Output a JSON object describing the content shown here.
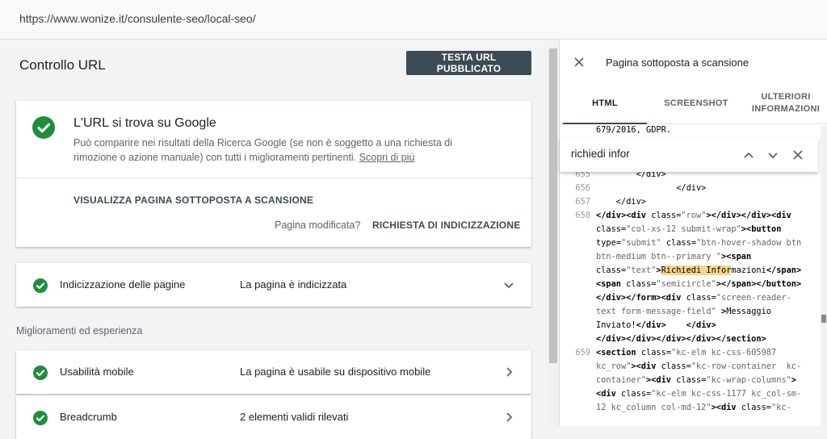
{
  "address_bar": {
    "url": "https://www.wonize.it/consulente-seo/local-seo/"
  },
  "page": {
    "title": "Controllo URL",
    "test_button": "TESTA URL PUBBLICATO"
  },
  "status": {
    "title": "L'URL si trova su Google",
    "description": "Può comparire nei risultati della Ricerca Google (se non è soggetto a una richiesta di rimozione o azione manuale) con tutti i miglioramenti pertinenti.",
    "learn_more": "Scopri di più",
    "view_crawled": "VISUALIZZA PAGINA SOTTOPOSTA A SCANSIONE",
    "modified_q": "Pagina modificata?",
    "request_indexing": "RICHIESTA DI INDICIZZAZIONE"
  },
  "indexing": {
    "label": "Indicizzazione delle pagine",
    "value": "La pagina è indicizzata"
  },
  "enhancements": {
    "header": "Miglioramenti ed esperienza",
    "items": [
      {
        "label": "Usabilità mobile",
        "value": "La pagina è usabile su dispositivo mobile"
      },
      {
        "label": "Breadcrumb",
        "value": "2 elementi validi rilevati"
      }
    ]
  },
  "panel": {
    "title": "Pagina sottoposta a scansione",
    "tabs": {
      "html": "HTML",
      "screenshot": "SCREENSHOT",
      "more_1": "ULTERIORI",
      "more_2": "INFORMAZIONI"
    },
    "search_value": "richiedi infor",
    "line_numbers": {
      "ln655": "655",
      "ln656": "656",
      "ln657": "657",
      "ln658": "658",
      "ln659": "659"
    }
  },
  "colors": {
    "success": "#1e8e3e",
    "button_dark": "#3c4b53",
    "highlight": "#f9d58a"
  },
  "icons": [
    "check-circle-icon",
    "chevron-down-icon",
    "chevron-right-icon",
    "close-icon",
    "arrow-up-icon",
    "arrow-down-icon"
  ]
}
